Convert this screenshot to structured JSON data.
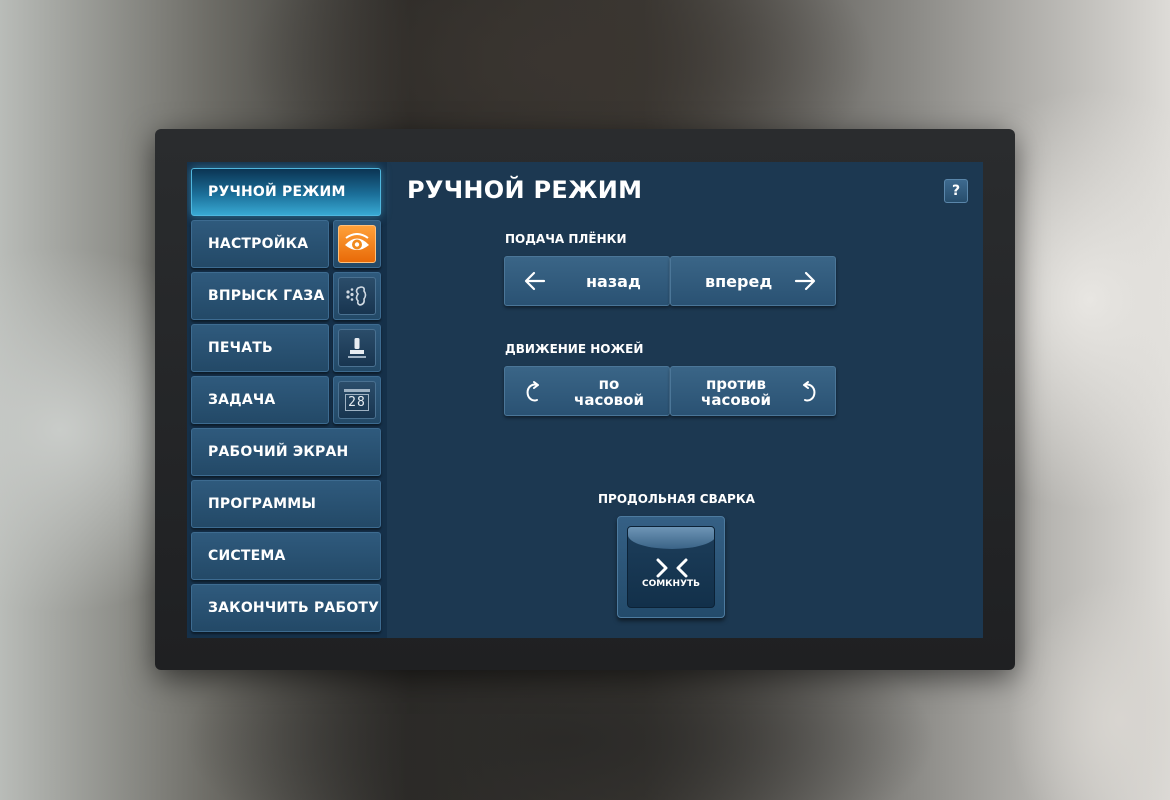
{
  "sidebar": {
    "items": [
      {
        "label": "РУЧНОЙ РЕЖИМ"
      },
      {
        "label": "НАСТРОЙКА"
      },
      {
        "label": "ВПРЫСК ГАЗА"
      },
      {
        "label": "ПЕЧАТЬ"
      },
      {
        "label": "ЗАДАЧА"
      },
      {
        "label": "РАБОЧИЙ ЭКРАН"
      },
      {
        "label": "ПРОГРАММЫ"
      },
      {
        "label": "СИСТЕМА"
      },
      {
        "label": "ЗАКОНЧИТЬ РАБОТУ"
      }
    ],
    "icons": {
      "setup": "eye-icon",
      "gas": "gas-injection-icon",
      "print": "stamp-icon",
      "task": "counter-icon",
      "task_counter": "28"
    }
  },
  "main": {
    "title": "РУЧНОЙ РЕЖИМ",
    "help_label": "?",
    "film_feed": {
      "label": "ПОДАЧА ПЛЁНКИ",
      "back_label": "назад",
      "forward_label": "вперед"
    },
    "knife_motion": {
      "label": "ДВИЖЕНИЕ НОЖЕЙ",
      "clockwise_line1": "по",
      "clockwise_line2": "часовой",
      "counter_line1": "против",
      "counter_line2": "часовой"
    },
    "long_weld": {
      "label": "ПРОДОЛЬНАЯ СВАРКА",
      "close_label": "СОМКНУТЬ"
    }
  },
  "colors": {
    "panel_bg": "#1c3851",
    "sidebar_bg": "#153049",
    "button": "#2f5a7d",
    "active": "#38a9d3",
    "orange": "#f5851f"
  }
}
